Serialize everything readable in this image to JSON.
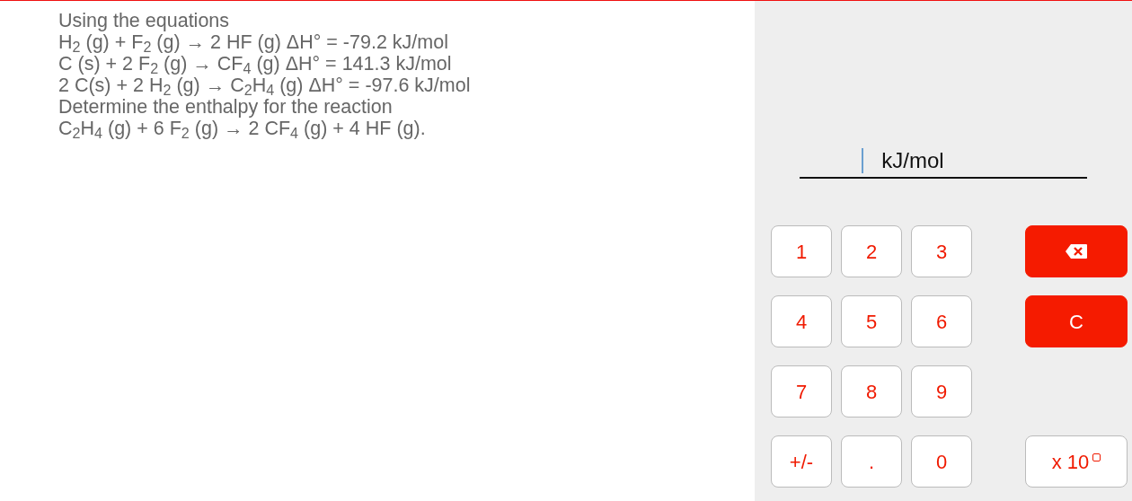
{
  "question": {
    "lines": [
      "Using the equations",
      "H$_{2}$ (g) + F$_{2}$ (g) → 2 HF (g) ΔH° = -79.2 kJ/mol",
      "C (s) + 2 F$_{2}$ (g) → CF$_{4}$ (g) ΔH° = 141.3 kJ/mol",
      "2 C(s) + 2 H$_{2}$ (g) → C$_{2}$H$_{4}$ (g) ΔH° = -97.6 kJ/mol",
      "Determine the enthalpy for the reaction",
      "C$_{2}$H$_{4}$ (g) + 6 F$_{2}$ (g) → 2 CF$_{4}$ (g) + 4 HF (g)."
    ]
  },
  "answer": {
    "unit": "kJ/mol"
  },
  "keypad": {
    "rows": [
      {
        "keys": [
          "1",
          "2",
          "3"
        ],
        "action": {
          "kind": "backspace"
        }
      },
      {
        "keys": [
          "4",
          "5",
          "6"
        ],
        "action": {
          "kind": "clear",
          "label": "C"
        }
      },
      {
        "keys": [
          "7",
          "8",
          "9"
        ]
      },
      {
        "keys": [
          "+/-",
          ".",
          "0"
        ],
        "action": {
          "kind": "exponent",
          "label": "x 10"
        }
      }
    ]
  }
}
